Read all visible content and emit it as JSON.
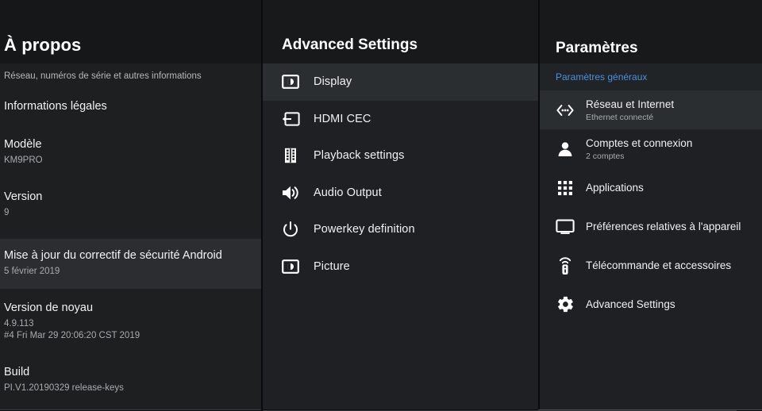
{
  "about": {
    "title": "À propos",
    "subtitle": "Réseau, numéros de série et autres informations",
    "rows": [
      {
        "label": "Informations légales",
        "value": "",
        "value2": ""
      },
      {
        "label": "Modèle",
        "value": "KM9PRO",
        "value2": ""
      },
      {
        "label": "Version",
        "value": "9",
        "value2": ""
      },
      {
        "label": "Mise à jour du correctif de sécurité Android",
        "value": "5 février 2019",
        "value2": ""
      },
      {
        "label": "Version de noyau",
        "value": "4.9.113",
        "value2": "#4 Fri Mar 29 20:06:20 CST 2019"
      },
      {
        "label": "Build",
        "value": "PI.V1.20190329 release-keys",
        "value2": ""
      }
    ]
  },
  "advanced": {
    "title": "Advanced Settings",
    "items": [
      {
        "label": "Display",
        "icon": "display-icon",
        "selected": true
      },
      {
        "label": "HDMI CEC",
        "icon": "hdmi-cec-icon",
        "selected": false
      },
      {
        "label": "Playback settings",
        "icon": "film-strip-icon",
        "selected": false
      },
      {
        "label": "Audio Output",
        "icon": "speaker-icon",
        "selected": false
      },
      {
        "label": "Powerkey definition",
        "icon": "power-icon",
        "selected": false
      },
      {
        "label": "Picture",
        "icon": "picture-icon",
        "selected": false
      }
    ]
  },
  "settings": {
    "title": "Paramètres",
    "section_label": "Paramètres généraux",
    "items": [
      {
        "label": "Réseau et Internet",
        "sub": "Ethernet connecté",
        "icon": "network-icon",
        "selected": true
      },
      {
        "label": "Comptes et connexion",
        "sub": "2 comptes",
        "icon": "account-icon",
        "selected": false
      },
      {
        "label": "Applications",
        "sub": "",
        "icon": "apps-grid-icon",
        "selected": false
      },
      {
        "label": "Préférences relatives à l'appareil",
        "sub": "",
        "icon": "monitor-icon",
        "selected": false
      },
      {
        "label": "Télécommande et accessoires",
        "sub": "",
        "icon": "remote-control-icon",
        "selected": false
      },
      {
        "label": "Advanced Settings",
        "sub": "",
        "icon": "gear-icon",
        "selected": false
      }
    ]
  },
  "colors": {
    "panel_bg": "#1e2023",
    "header_bg": "#17191b",
    "selected_row": "#2b2e31",
    "accent_blue": "#4d8fdd",
    "primary_text": "#f0f1f2",
    "secondary_text": "#a9acae"
  }
}
